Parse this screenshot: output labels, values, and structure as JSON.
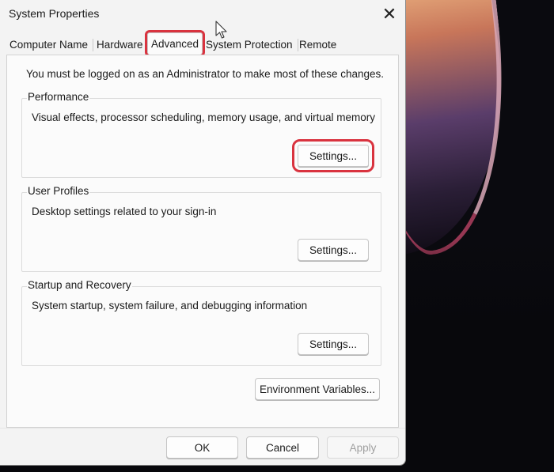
{
  "window": {
    "title": "System Properties",
    "close_glyph": "✕"
  },
  "tabs": [
    {
      "label": "Computer Name",
      "active": false
    },
    {
      "label": "Hardware",
      "active": false
    },
    {
      "label": "Advanced",
      "active": true
    },
    {
      "label": "System Protection",
      "active": false
    },
    {
      "label": "Remote",
      "active": false
    }
  ],
  "notice": "You must be logged on as an Administrator to make most of these changes.",
  "groups": {
    "performance": {
      "title": "Performance",
      "description": "Visual effects, processor scheduling, memory usage, and virtual memory",
      "button": "Settings..."
    },
    "user_profiles": {
      "title": "User Profiles",
      "description": "Desktop settings related to your sign-in",
      "button": "Settings..."
    },
    "startup_recovery": {
      "title": "Startup and Recovery",
      "description": "System startup, system failure, and debugging information",
      "button": "Settings..."
    }
  },
  "environment_button": "Environment Variables...",
  "footer": {
    "ok": "OK",
    "cancel": "Cancel",
    "apply": "Apply"
  },
  "colors": {
    "highlight": "#d9333f",
    "dialog_bg": "#f3f3f3",
    "panel_bg": "#fbfbfb"
  }
}
